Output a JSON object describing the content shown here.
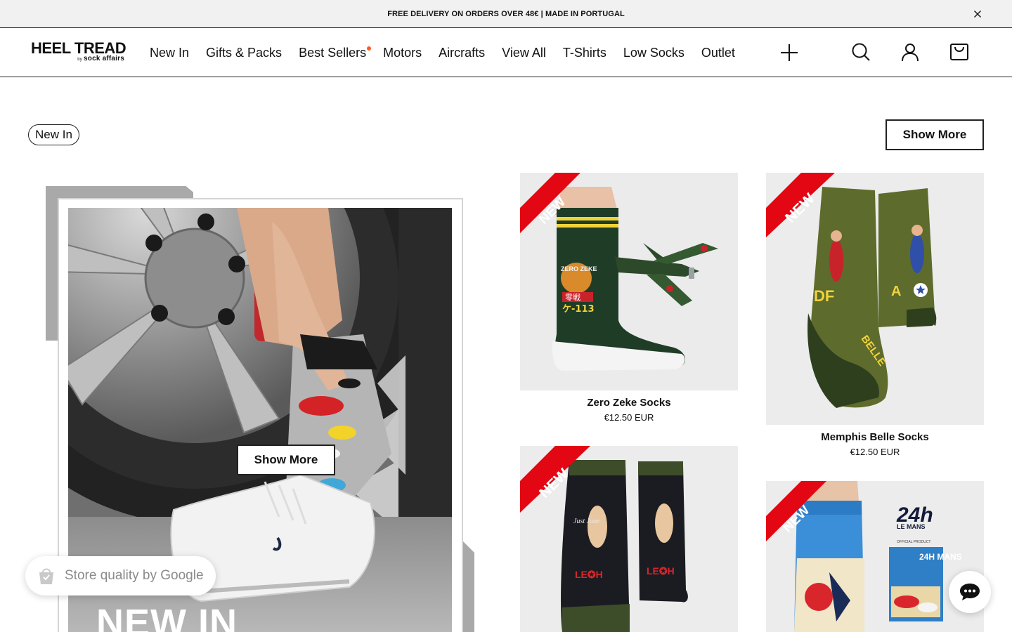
{
  "announcement": {
    "text": "FREE DELIVERY ON ORDERS OVER 48€ | MADE IN PORTUGAL",
    "close_icon": "close-icon"
  },
  "header": {
    "logo_main": "HEEL TREAD",
    "logo_by": "by",
    "logo_sub": "sock affairs",
    "nav": [
      {
        "label": "New In"
      },
      {
        "label": "Gifts & Packs"
      },
      {
        "label": "Best Sellers",
        "dot": true
      },
      {
        "label": "Motors"
      },
      {
        "label": "Aircrafts"
      },
      {
        "label": "View All"
      },
      {
        "label": "T-Shirts"
      },
      {
        "label": "Low Socks"
      },
      {
        "label": "Outlet"
      }
    ],
    "icons": [
      "plus-icon",
      "search-icon",
      "account-icon",
      "cart-icon"
    ],
    "dot_color": "#ff5a1f"
  },
  "section": {
    "pill_label": "New In",
    "show_more_label": "Show More"
  },
  "hero": {
    "title": "NEW IN",
    "button_label": "Show More"
  },
  "products": [
    {
      "name": "Zero Zeke Socks",
      "price": "€12.50 EUR",
      "badge": "NEW"
    },
    {
      "name": "Memphis Belle Socks",
      "price": "€12.50 EUR",
      "badge": "NEW"
    },
    {
      "name": "",
      "price": "",
      "badge": "NEW"
    },
    {
      "name": "",
      "price": "",
      "badge": "NEW"
    }
  ],
  "product_art": {
    "zero_zeke_sock_text": "ZERO ZEKE",
    "zero_zeke_kanji": "零戦",
    "zero_zeke_code": "ケ-113",
    "memphis_letters_left": "DF",
    "memphis_letters_right": "A",
    "memphis_belle": "BELLE",
    "jane_left": "Just Jane",
    "jane_code": "LE✪H",
    "lemans_logo": "24h",
    "lemans_name": "LE MANS",
    "lemans_official": "OFFICIAL PRODUCT",
    "lemans_poster": "24H MANS"
  },
  "badge_text": "Store quality by Google",
  "colors": {
    "ribbon": "#e30613",
    "announce_bg": "#f1f1f1",
    "sock_green": "#1f3d26",
    "sock_olive": "#5d6b2c"
  }
}
